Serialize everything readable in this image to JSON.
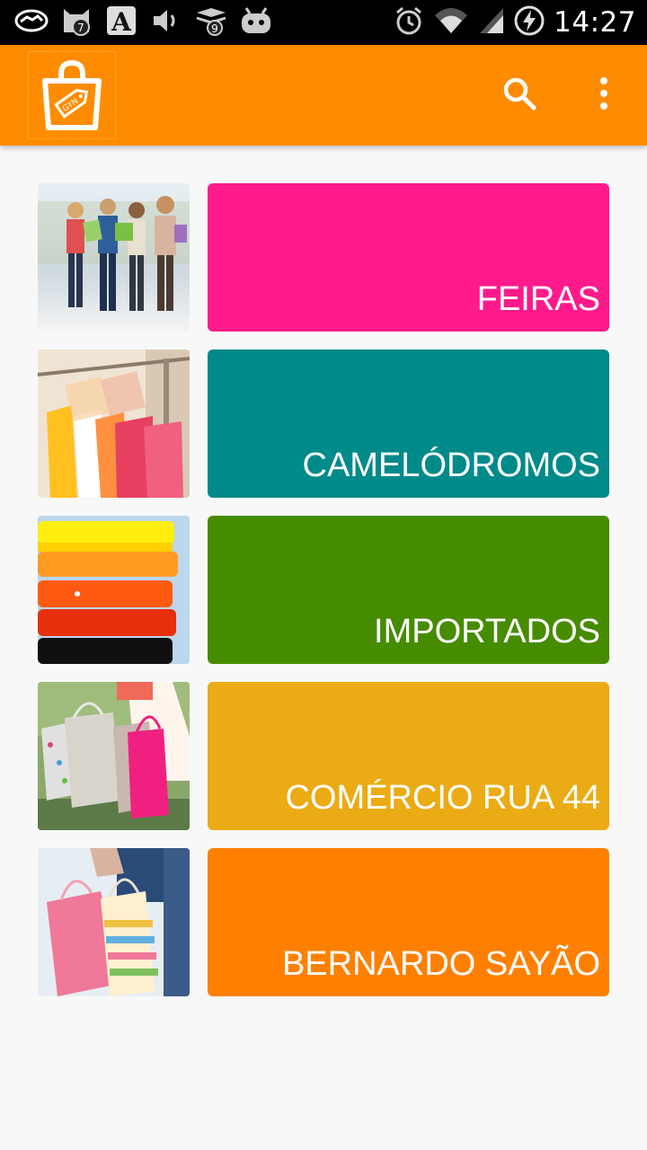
{
  "status_bar": {
    "time": "14:27",
    "left_icons": [
      "handshake-icon",
      "cat-badge-icon",
      "text-app-icon",
      "volume-icon",
      "layers-badge-icon",
      "robot-icon"
    ],
    "right_icons": [
      "alarm-icon",
      "wifi-icon",
      "signal-icon",
      "battery-charging-icon"
    ],
    "badges": {
      "cat": "7",
      "layers": "9"
    }
  },
  "app_bar": {
    "color": "#ff8c00",
    "logo_icon": "shopping-bag-logo-icon",
    "logo_tag_text": "GYN",
    "actions": [
      "search-icon",
      "overflow-menu-icon"
    ]
  },
  "categories": [
    {
      "label": "FEIRAS",
      "color": "#ff1a8c",
      "image": "shoppers-walking-photo"
    },
    {
      "label": "CAMELÓDROMOS",
      "color": "#008a8a",
      "image": "clothes-rack-photo"
    },
    {
      "label": "IMPORTADOS",
      "color": "#468c00",
      "image": "folded-shirts-photo"
    },
    {
      "label": "COMÉRCIO RUA 44",
      "color": "#ebab14",
      "image": "shopping-bags-photo"
    },
    {
      "label": "BERNARDO SAYÃO",
      "color": "#ff8000",
      "image": "pink-bags-photo"
    }
  ]
}
